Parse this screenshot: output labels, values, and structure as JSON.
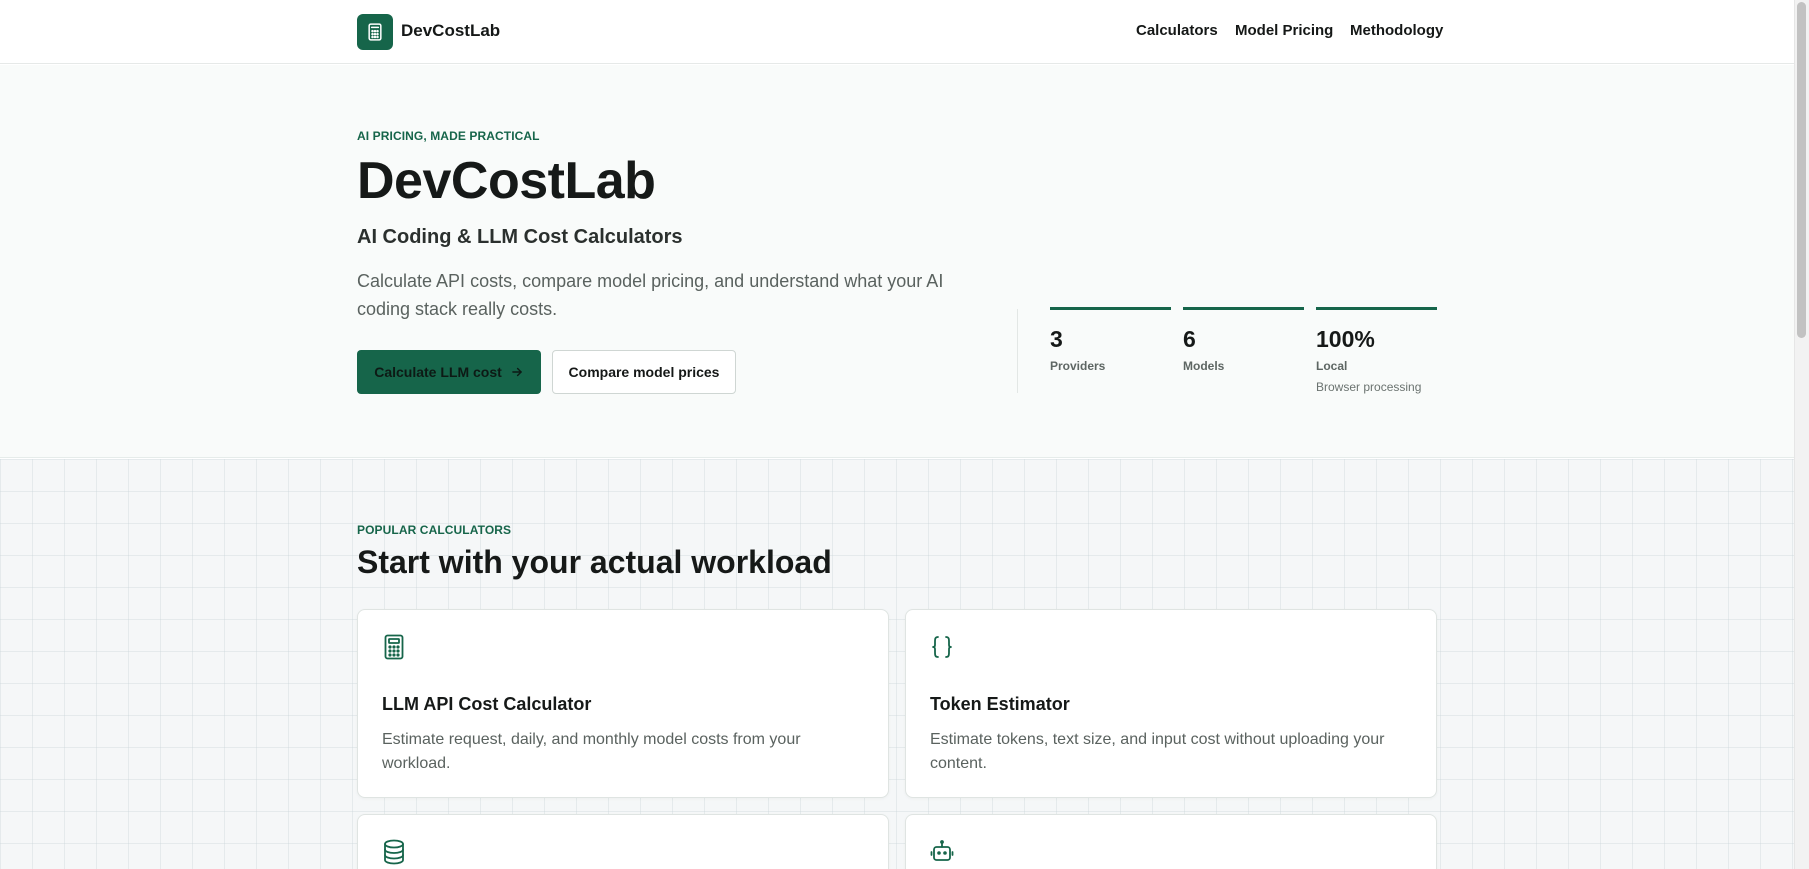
{
  "brand": {
    "name": "DevCostLab",
    "icon": "calculator-icon",
    "color": "#16654a"
  },
  "nav": {
    "items": [
      {
        "label": "Calculators"
      },
      {
        "label": "Model Pricing"
      },
      {
        "label": "Methodology"
      }
    ]
  },
  "hero": {
    "eyebrow": "AI PRICING, MADE PRACTICAL",
    "title": "DevCostLab",
    "subtitle": "AI Coding & LLM Cost Calculators",
    "description": "Calculate API costs, compare model pricing, and understand what your AI coding stack really costs.",
    "primary_button": "Calculate LLM cost",
    "primary_icon": "arrow-right-icon",
    "secondary_button": "Compare model prices",
    "stats": [
      {
        "value": "3",
        "label": "Providers",
        "sub": ""
      },
      {
        "value": "6",
        "label": "Models",
        "sub": ""
      },
      {
        "value": "100%",
        "label": "Local",
        "sub": "Browser processing"
      }
    ]
  },
  "popular": {
    "eyebrow": "POPULAR CALCULATORS",
    "title": "Start with your actual workload",
    "cards": [
      {
        "icon": "calculator-icon",
        "title": "LLM API Cost Calculator",
        "description": "Estimate request, daily, and monthly model costs from your workload."
      },
      {
        "icon": "braces-icon",
        "title": "Token Estimator",
        "description": "Estimate tokens, text size, and input cost without uploading your content."
      },
      {
        "icon": "database-icon",
        "title": "",
        "description": ""
      },
      {
        "icon": "bot-icon",
        "title": "",
        "description": ""
      }
    ]
  }
}
